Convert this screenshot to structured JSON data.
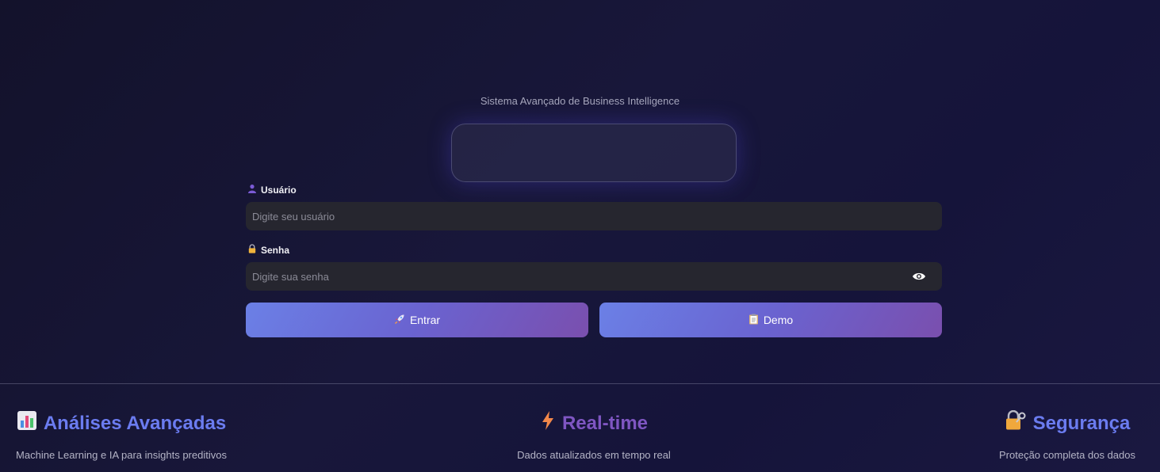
{
  "header": {
    "subtitle": "Sistema Avançado de Business Intelligence"
  },
  "form": {
    "username": {
      "icon": "user-icon",
      "label": "Usuário",
      "placeholder": "Digite seu usuário",
      "value": ""
    },
    "password": {
      "icon": "lock-icon",
      "label": "Senha",
      "placeholder": "Digite sua senha",
      "value": "",
      "toggle_icon": "eye-icon"
    },
    "buttons": {
      "login": {
        "icon": "rocket-icon",
        "label": "Entrar"
      },
      "demo": {
        "icon": "clipboard-icon",
        "label": "Demo"
      }
    }
  },
  "features": [
    {
      "icon": "bar-chart-icon",
      "title": "Análises Avançadas",
      "description": "Machine Learning e IA para insights preditivos",
      "color": "#6b7cf0"
    },
    {
      "icon": "lightning-icon",
      "title": "Real-time",
      "description": "Dados atualizados em tempo real",
      "color": "#7f56c2"
    },
    {
      "icon": "lock-key-icon",
      "title": "Segurança",
      "description": "Proteção completa dos dados",
      "color": "#6b7cf0"
    }
  ],
  "colors": {
    "accent_blue": "#6b80e6",
    "accent_purple": "#7a4fae",
    "input_bg": "#26262f",
    "background": "#15143a"
  }
}
